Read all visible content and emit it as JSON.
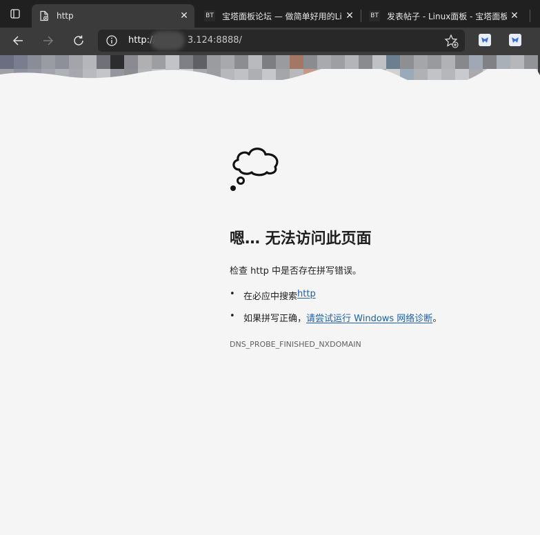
{
  "tabs": [
    {
      "title": "http",
      "favicon": "page-error-icon",
      "active": true
    },
    {
      "title": "宝塔面板论坛 — 做简单好用的Li",
      "favicon": "bt-logo"
    },
    {
      "title": "发表帖子 - Linux面板 - 宝塔面板",
      "favicon": "bt-logo"
    }
  ],
  "tab_close_glyph": "✕",
  "bt_text": "BT",
  "address": {
    "scheme": "http://",
    "host_visible": "3.124:8888/"
  },
  "error": {
    "headline": "嗯… 无法访问此页面",
    "check_prefix": "检查 http 中是否存在拼写错误。",
    "bullet1_prefix": "在必应中搜索 ",
    "bullet1_link": "http",
    "bullet2_prefix": "如果拼写正确，",
    "bullet2_link": "请尝试运行 Windows 网络诊断",
    "bullet2_suffix": "。",
    "bullet_glyph": "•",
    "code": "DNS_PROBE_FINISHED_NXDOMAIN"
  },
  "colors": {
    "tabstrip": "#202020",
    "toolbar": "#3b3b3b",
    "omnibox": "#282828",
    "page_bg": "#f5f5f5",
    "link": "#1a5fa8"
  }
}
